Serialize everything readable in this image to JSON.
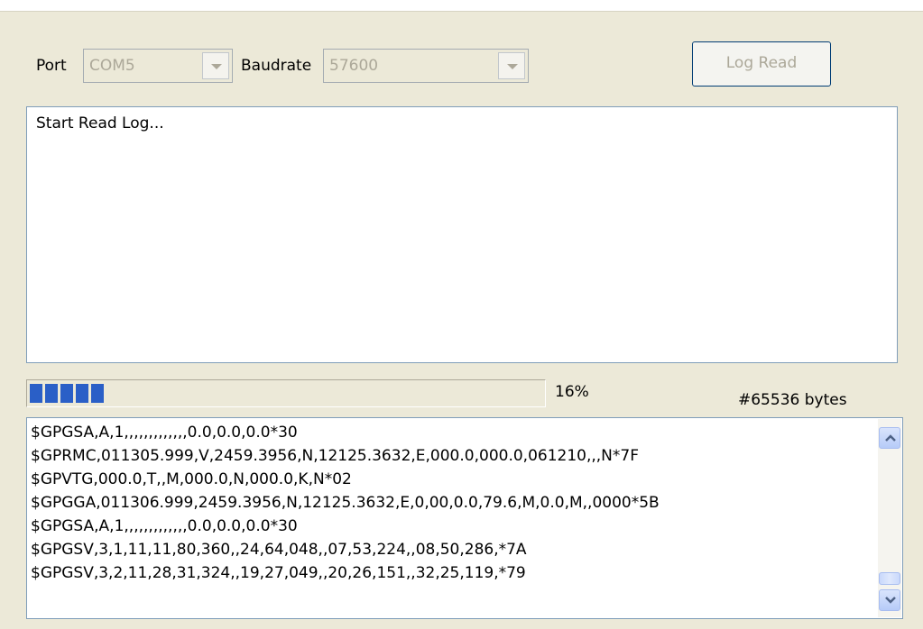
{
  "port": {
    "label": "Port",
    "value": "COM5"
  },
  "baudrate": {
    "label": "Baudrate",
    "value": "57600"
  },
  "log_read_button": "Log Read",
  "status_text": "Start Read Log...",
  "progress": {
    "percent_label": "16%",
    "fraction": 0.16
  },
  "bytes_label": "#65536 bytes",
  "log_lines": [
    "$GPGSA,A,1,,,,,,,,,,,,,0.0,0.0,0.0*30",
    "$GPRMC,011305.999,V,2459.3956,N,12125.3632,E,000.0,000.0,061210,,,N*7F",
    "$GPVTG,000.0,T,,M,000.0,N,000.0,K,N*02",
    "$GPGGA,011306.999,2459.3956,N,12125.3632,E,0,00,0.0,79.6,M,0.0,M,,0000*5B",
    "$GPGSA,A,1,,,,,,,,,,,,,0.0,0.0,0.0*30",
    "$GPGSV,3,1,11,11,80,360,,24,64,048,,07,53,224,,08,50,286,*7A",
    "$GPGSV,3,2,11,28,31,324,,19,27,049,,20,26,151,,32,25,119,*79"
  ],
  "icons": {
    "scroll_up": "chevron-up-icon",
    "scroll_down": "chevron-down-icon",
    "combo": "dropdown-arrow-icon"
  }
}
